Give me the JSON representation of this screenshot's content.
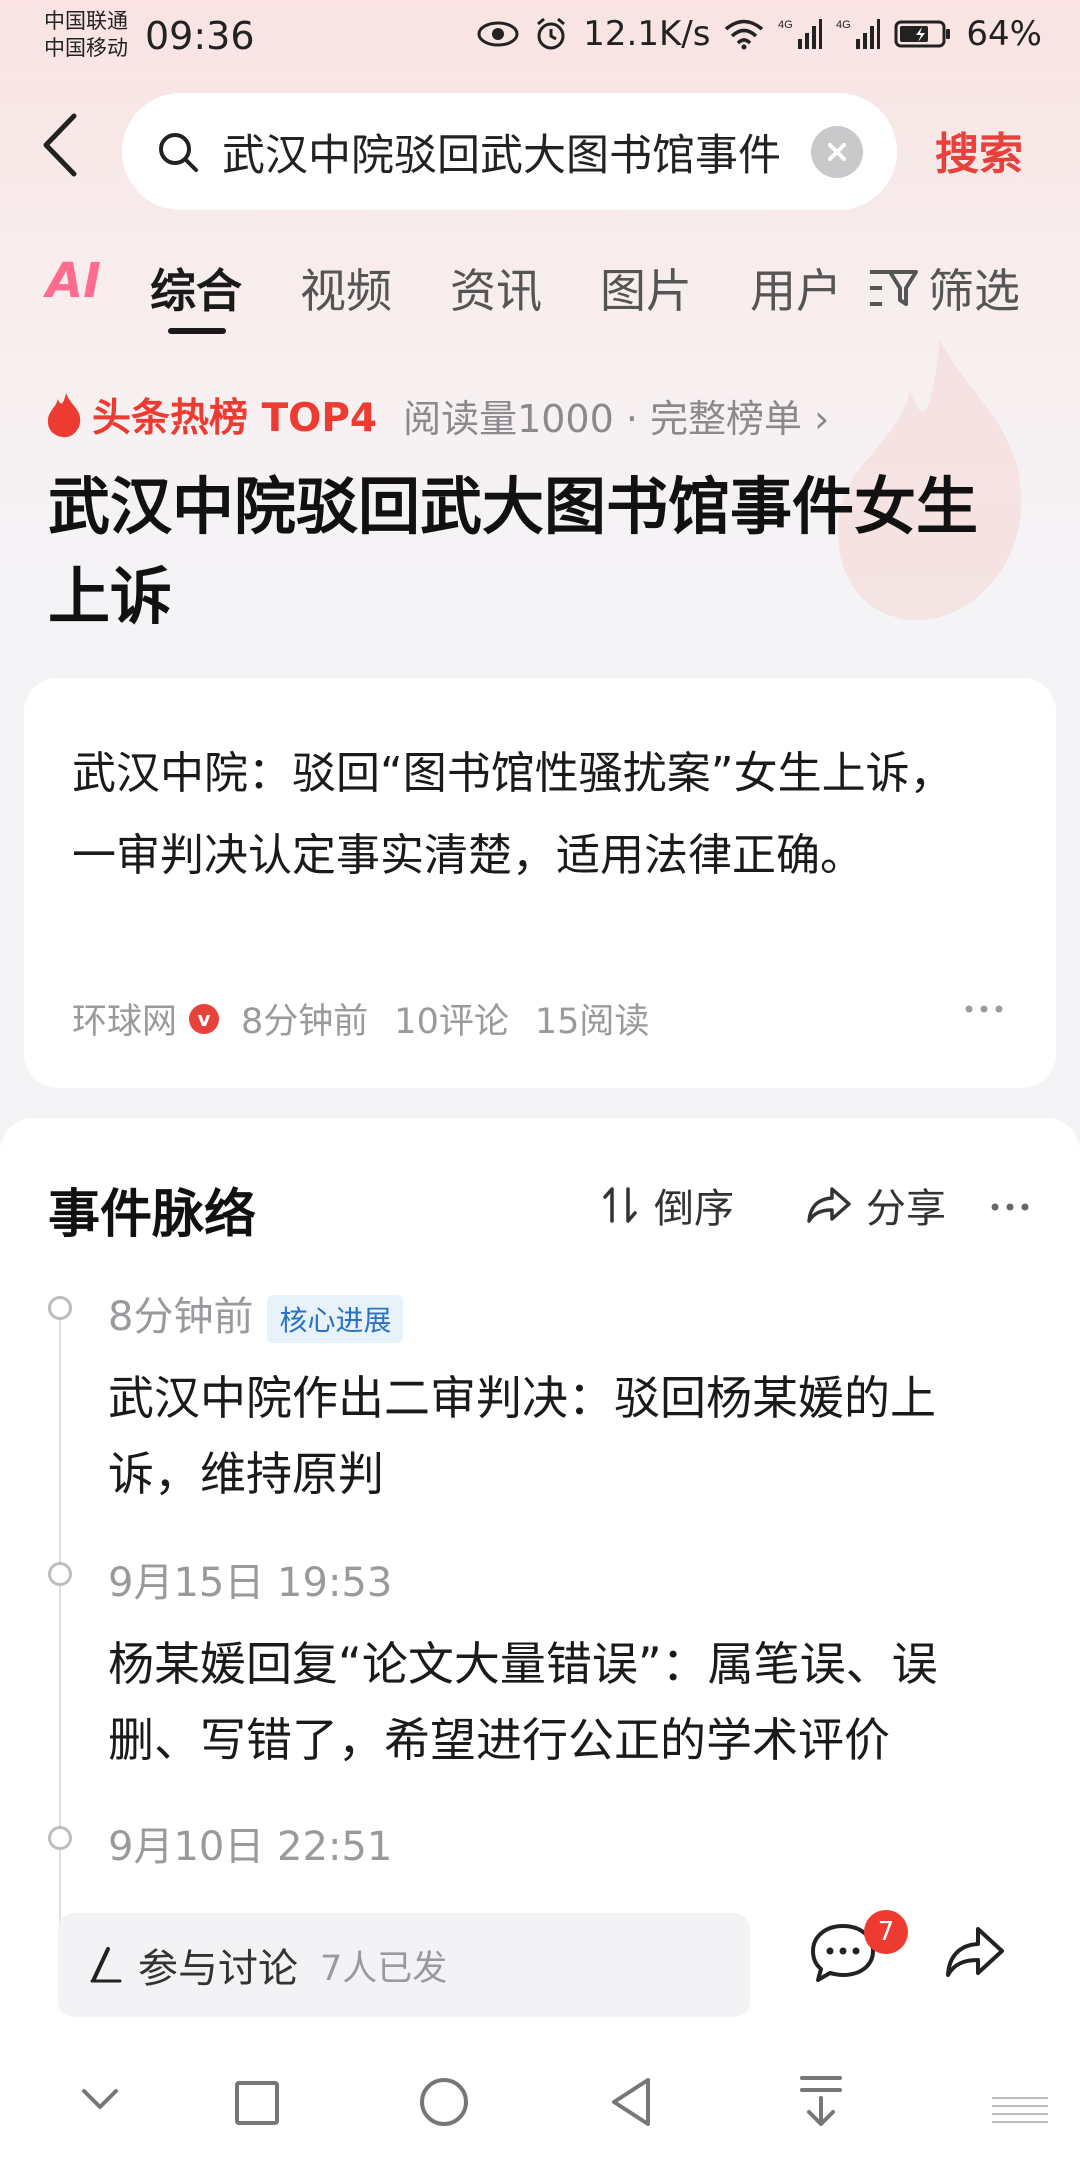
{
  "status": {
    "carrier1": "中国联通",
    "carrier2": "中国移动",
    "time": "09:36",
    "net_speed": "12.1K/s",
    "battery": "64%"
  },
  "search": {
    "query": "武汉中院驳回武大图书馆事件",
    "submit_label": "搜索"
  },
  "tabs": {
    "ai": "AI",
    "items": [
      "综合",
      "视频",
      "资讯",
      "图片",
      "用户"
    ],
    "filter": "筛选"
  },
  "hot": {
    "label": "头条热榜 TOP4",
    "meta": "阅读量1000 · 完整榜单 ›"
  },
  "page_title": "武汉中院驳回武大图书馆事件女生上诉",
  "article": {
    "text": "武汉中院：驳回“图书馆性骚扰案”女生上诉，一审判决认定事实清楚，适用法律正确。",
    "source": "环球网",
    "verified": "v",
    "time": "8分钟前",
    "comments": "10评论",
    "reads": "15阅读"
  },
  "timeline": {
    "title": "事件脉络",
    "sort_label": "倒序",
    "share_label": "分享",
    "events": [
      {
        "time": "8分钟前",
        "tag": "核心进展",
        "text": "武汉中院作出二审判决：驳回杨某媛的上诉，维持原判"
      },
      {
        "time": "9月15日 19:53",
        "tag": "",
        "text": "杨某媛回复“论文大量错误”：属笔误、误删、写错了，希望进行公正的学术评价"
      },
      {
        "time": "9月10日 22:51",
        "tag": "",
        "text": ""
      }
    ]
  },
  "bottom": {
    "discuss_label": "参与讨论",
    "discuss_count": "7人已发",
    "comment_badge": "7"
  },
  "colors": {
    "accent": "#e8403a",
    "hot": "#ee3b31",
    "tag_bg": "#e8f2fb",
    "tag_text": "#2a73c2"
  }
}
